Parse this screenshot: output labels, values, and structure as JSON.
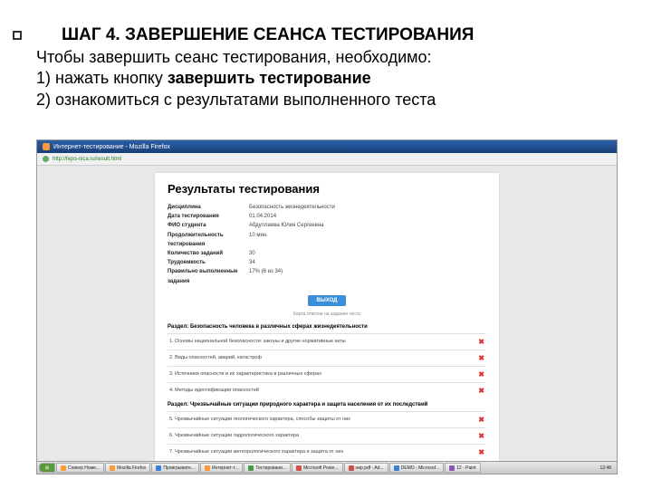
{
  "slide": {
    "title": "ШАГ 4. ЗАВЕРШЕНИЕ СЕАНСА ТЕСТИРОВАНИЯ",
    "line1": "Чтобы завершить сеанс тестирования, необходимо:",
    "line2a": "1) нажать кнопку ",
    "line2b": "завершить тестирование",
    "line3": "2) ознакомиться с результатами выполненного теста"
  },
  "browser": {
    "title": "Интернет-тестирование - Mozilla Firefox",
    "url": "http://fepo-nica.ru/result.html"
  },
  "results": {
    "heading": "Результаты тестирования",
    "rows": [
      {
        "label": "Дисциплина",
        "value": "Безопасность жизнедеятельности"
      },
      {
        "label": "Дата тестирования",
        "value": "01.04.2014"
      },
      {
        "label": "ФИО студента",
        "value": "Абдуллаева Юлия Сергеевна"
      },
      {
        "label": "Продолжительность тестирования",
        "value": "10 мин."
      },
      {
        "label": "Количество заданий",
        "value": "30"
      },
      {
        "label": "Трудоемкость",
        "value": "34"
      },
      {
        "label": "Правильно выполненные задания",
        "value": "17% (6 из 34)"
      }
    ],
    "exit": "ВЫХОД",
    "subcaption": "Карта ответов на задания теста",
    "section1": "Раздел: Безопасность человека в различных сферах жизнедеятельности",
    "q1": "1. Основы национальной безопасности: законы и другие нормативные акты",
    "q2": "2. Виды опасностей, аварий, катастроф",
    "q3": "3. Источники опасности и их характеристика в различных сферах",
    "q4": "4. Методы идентификации опасностей",
    "section2": "Раздел: Чрезвычайные ситуации природного характера и защита населения от их последствий",
    "q5": "5. Чрезвычайные ситуации геологического характера, способы защиты от них",
    "q6": "6. Чрезвычайные ситуации гидрологического характера",
    "q7": "7. Чрезвычайные ситуации метеорологического характера и защита от них"
  },
  "taskbar": {
    "items": [
      "Спикер Номе...",
      "Mozilla Firefox",
      "Проигрывате...",
      "Интернет-т...",
      "Тестировани...",
      "Microsoft Powe...",
      "нир.pdf - Ad...",
      "DEMO - Microsof...",
      "12 - Paint"
    ],
    "time": "12:48"
  }
}
